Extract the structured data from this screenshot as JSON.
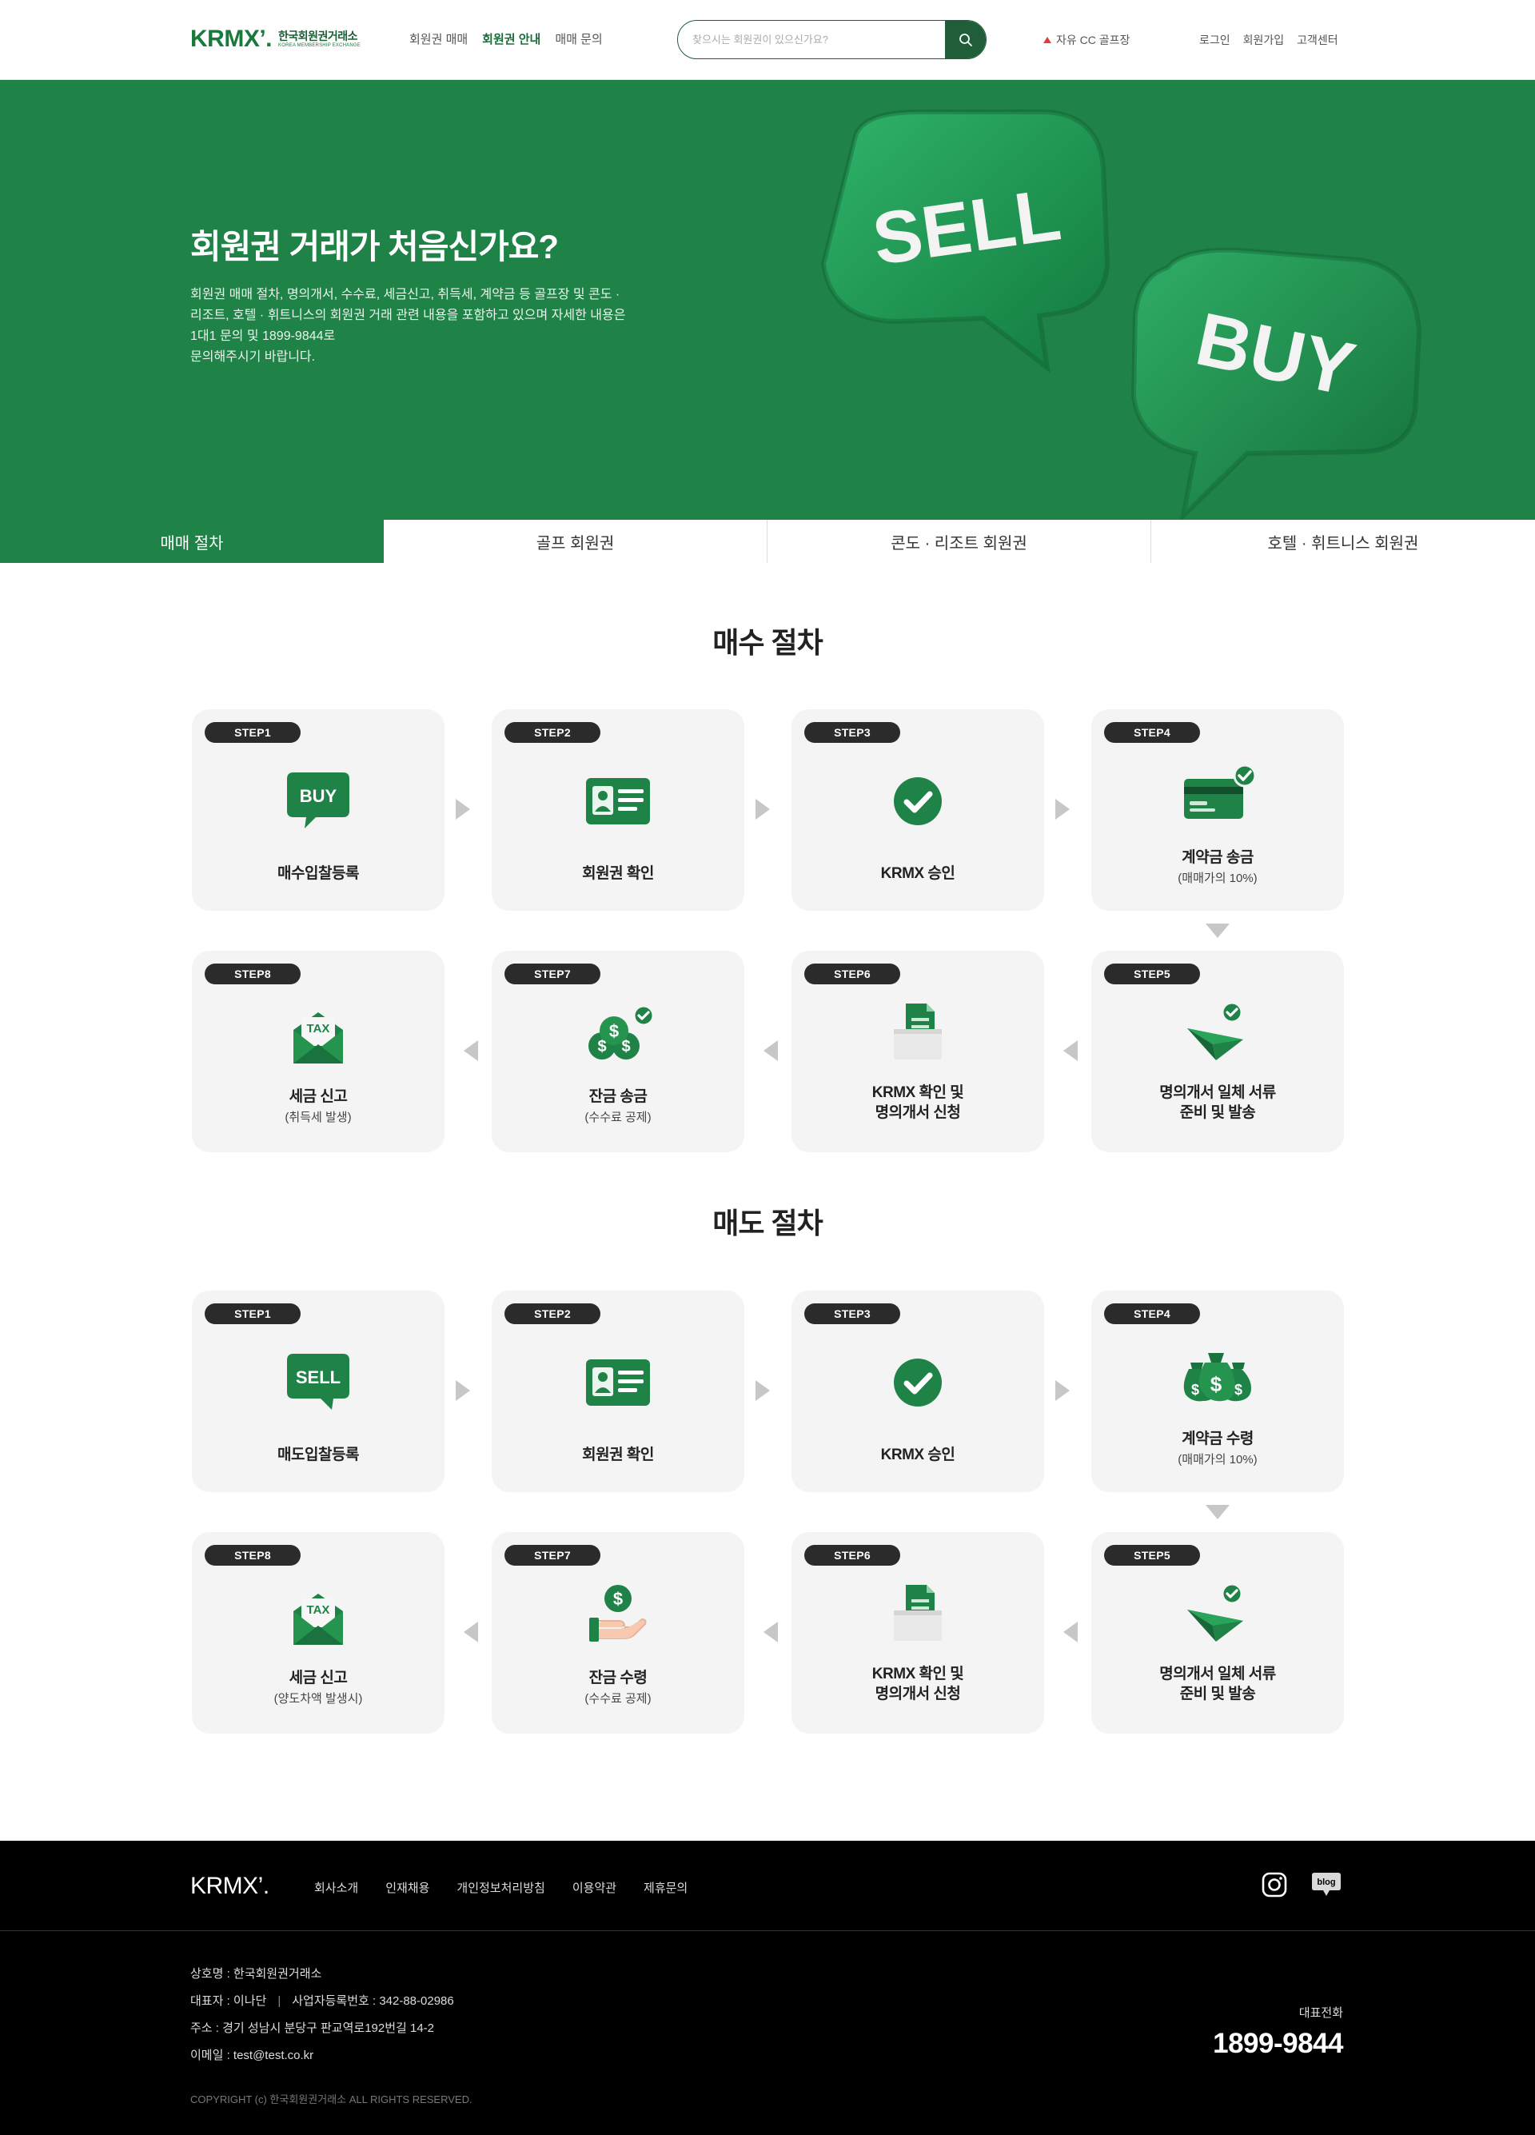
{
  "header": {
    "logo_text": "KRMX",
    "logo_mark": "’.",
    "logo_ko": "한국회원권거래소",
    "logo_en": "KOREA MEMBERSHIP EXCHANGE",
    "nav": [
      {
        "label": "회원권 매매",
        "active": false
      },
      {
        "label": "회원권 안내",
        "active": true
      },
      {
        "label": "매매 문의",
        "active": false
      }
    ],
    "search_placeholder": "찾으시는 회원권이 있으신가요?",
    "rank_item": "자유 CC 골프장",
    "util": [
      "로그인",
      "회원가입",
      "고객센터"
    ]
  },
  "hero": {
    "title": "회원권 거래가 처음신가요?",
    "description_lines": [
      "회원권 매매 절차, 명의개서, 수수료, 세금신고, 취득세, 계약금 등 골프장 및 콘도 ·",
      "리조트, 호텔 · 휘트니스의 회원권 거래 관련 내용을 포함하고 있으며 자세한 내용은",
      "1대1 문의 및 1899-9844로",
      "문의해주시기 바랍니다."
    ],
    "bubble_sell": "SELL",
    "bubble_buy": "BUY",
    "bg_color": "#1f8247"
  },
  "tabs": [
    {
      "label": "매매 절차",
      "active": true
    },
    {
      "label": "골프 회원권",
      "active": false
    },
    {
      "label": "콘도 · 리조트 회원권",
      "active": false
    },
    {
      "label": "호텔 · 휘트니스 회원권",
      "active": false
    }
  ],
  "buy_section": {
    "title": "매수 절차",
    "steps": [
      {
        "badge": "STEP1",
        "title": "매수입찰등록",
        "sub": "",
        "icon": "buy-bubble-icon"
      },
      {
        "badge": "STEP2",
        "title": "회원권 확인",
        "sub": "",
        "icon": "id-card-icon"
      },
      {
        "badge": "STEP3",
        "title": "KRMX 승인",
        "sub": "",
        "icon": "check-circle-icon"
      },
      {
        "badge": "STEP4",
        "title": "계약금 송금",
        "sub": "(매매가의 10%)",
        "icon": "credit-card-icon"
      },
      {
        "badge": "STEP5",
        "title": "명의개서 일체 서류\n준비 및 발송",
        "sub": "",
        "icon": "paper-plane-icon"
      },
      {
        "badge": "STEP6",
        "title": "KRMX 확인 및\n명의개서 신청",
        "sub": "",
        "icon": "document-tray-icon"
      },
      {
        "badge": "STEP7",
        "title": "잔금 송금",
        "sub": "(수수료 공제)",
        "icon": "coins-icon"
      },
      {
        "badge": "STEP8",
        "title": "세금 신고",
        "sub": "(취득세 발생)",
        "icon": "tax-envelope-icon"
      }
    ]
  },
  "sell_section": {
    "title": "매도 절차",
    "steps": [
      {
        "badge": "STEP1",
        "title": "매도입찰등록",
        "sub": "",
        "icon": "sell-bubble-icon"
      },
      {
        "badge": "STEP2",
        "title": "회원권 확인",
        "sub": "",
        "icon": "id-card-icon"
      },
      {
        "badge": "STEP3",
        "title": "KRMX 승인",
        "sub": "",
        "icon": "check-circle-icon"
      },
      {
        "badge": "STEP4",
        "title": "계약금 수령",
        "sub": "(매매가의 10%)",
        "icon": "money-bags-icon"
      },
      {
        "badge": "STEP5",
        "title": "명의개서 일체 서류\n준비 및 발송",
        "sub": "",
        "icon": "paper-plane-icon"
      },
      {
        "badge": "STEP6",
        "title": "KRMX 확인 및\n명의개서 신청",
        "sub": "",
        "icon": "document-tray-icon"
      },
      {
        "badge": "STEP7",
        "title": "잔금 수령",
        "sub": "(수수료 공제)",
        "icon": "hand-coin-icon"
      },
      {
        "badge": "STEP8",
        "title": "세금 신고",
        "sub": "(양도차액 발생시)",
        "icon": "tax-envelope-icon"
      }
    ]
  },
  "footer": {
    "logo_text": "KRMX’.",
    "nav": [
      "회사소개",
      "인재채용",
      "개인정보처리방침",
      "이용약관",
      "제휴문의"
    ],
    "company": "상호명 : 한국회원권거래소",
    "ceo": "대표자 : 이나단",
    "biz_no": "사업자등록번호 : 342-88-02986",
    "address": "주소 : 경기 성남시 분당구 판교역로192번길 14-2",
    "email": "이메일 : test@test.co.kr",
    "copyright": "COPYRIGHT (c) 한국회원권거래소 ALL RIGHTS RESERVED.",
    "tel_label": "대표전화",
    "tel": "1899-9844",
    "blog_label": "blog"
  },
  "colors": {
    "brand_green": "#1f8247",
    "dark_green": "#1f5e38",
    "card_bg": "#f4f4f4",
    "badge_bg": "#2b2b2b"
  }
}
